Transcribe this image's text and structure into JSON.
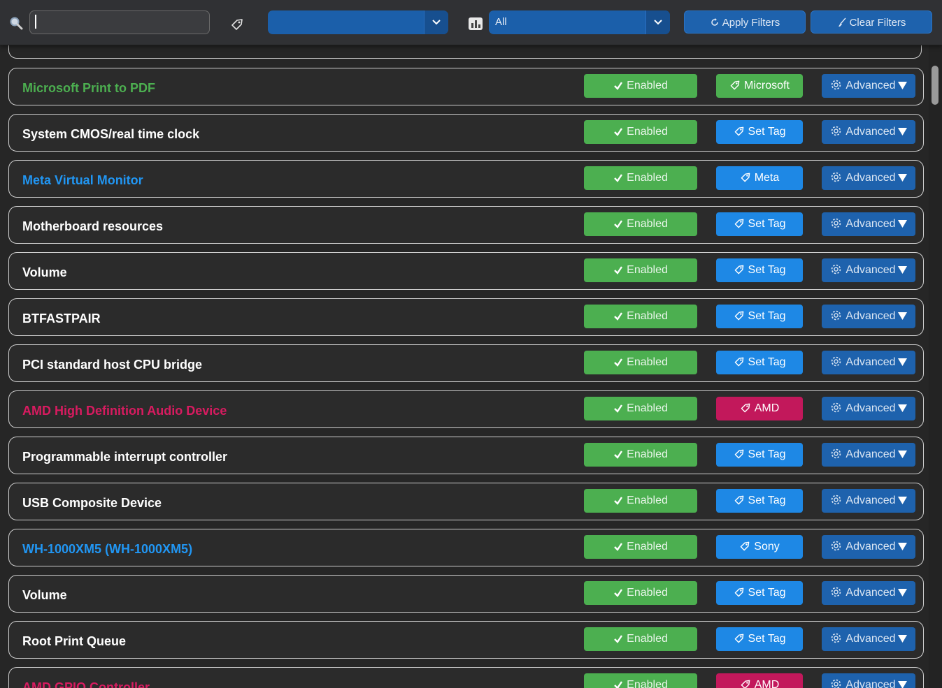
{
  "toolbar": {
    "search_value": "",
    "tag_filter_value": "",
    "status_filter_value": "All",
    "apply_label": "Apply Filters",
    "clear_label": "Clear Filters",
    "icons": [
      "search-icon",
      "tag-icon",
      "chevron-down-icon",
      "bar-chart-icon",
      "refresh-icon",
      "broom-icon"
    ]
  },
  "status_labels": {
    "enabled": "Enabled"
  },
  "advanced_label": "Advanced",
  "colors": {
    "enabled_green": "#4caf50",
    "set_tag_blue": "#1e88e5",
    "amd_red": "#c2185b",
    "advanced_blue": "#1e62ad",
    "microsoft_name_green": "#4caf50",
    "meta_name_blue": "#2196f3",
    "sony_name_blue": "#2196f3",
    "amd_name_red": "#d81b60"
  },
  "devices": [
    {
      "name": "Microsoft Print to PDF",
      "status": "Enabled",
      "tag": "Microsoft",
      "tag_style": "green",
      "name_color": "#4caf50"
    },
    {
      "name": "System CMOS/real time clock",
      "status": "Enabled",
      "tag": "Set Tag",
      "tag_style": "blue",
      "name_color": "#ffffff"
    },
    {
      "name": "Meta Virtual Monitor",
      "status": "Enabled",
      "tag": "Meta",
      "tag_style": "blue",
      "name_color": "#2196f3"
    },
    {
      "name": "Motherboard resources",
      "status": "Enabled",
      "tag": "Set Tag",
      "tag_style": "blue",
      "name_color": "#ffffff"
    },
    {
      "name": "Volume",
      "status": "Enabled",
      "tag": "Set Tag",
      "tag_style": "blue",
      "name_color": "#ffffff"
    },
    {
      "name": "BTFASTPAIR",
      "status": "Enabled",
      "tag": "Set Tag",
      "tag_style": "blue",
      "name_color": "#ffffff"
    },
    {
      "name": "PCI standard host CPU bridge",
      "status": "Enabled",
      "tag": "Set Tag",
      "tag_style": "blue",
      "name_color": "#ffffff"
    },
    {
      "name": "AMD High Definition Audio Device",
      "status": "Enabled",
      "tag": "AMD",
      "tag_style": "red",
      "name_color": "#d81b60"
    },
    {
      "name": "Programmable interrupt controller",
      "status": "Enabled",
      "tag": "Set Tag",
      "tag_style": "blue",
      "name_color": "#ffffff"
    },
    {
      "name": "USB Composite Device",
      "status": "Enabled",
      "tag": "Set Tag",
      "tag_style": "blue",
      "name_color": "#ffffff"
    },
    {
      "name": "WH-1000XM5 (WH-1000XM5)",
      "status": "Enabled",
      "tag": "Sony",
      "tag_style": "blue",
      "name_color": "#2196f3"
    },
    {
      "name": "Volume",
      "status": "Enabled",
      "tag": "Set Tag",
      "tag_style": "blue",
      "name_color": "#ffffff"
    },
    {
      "name": "Root Print Queue",
      "status": "Enabled",
      "tag": "Set Tag",
      "tag_style": "blue",
      "name_color": "#ffffff"
    },
    {
      "name": "AMD GPIO Controller",
      "status": "Enabled",
      "tag": "AMD",
      "tag_style": "red",
      "name_color": "#d81b60"
    }
  ]
}
